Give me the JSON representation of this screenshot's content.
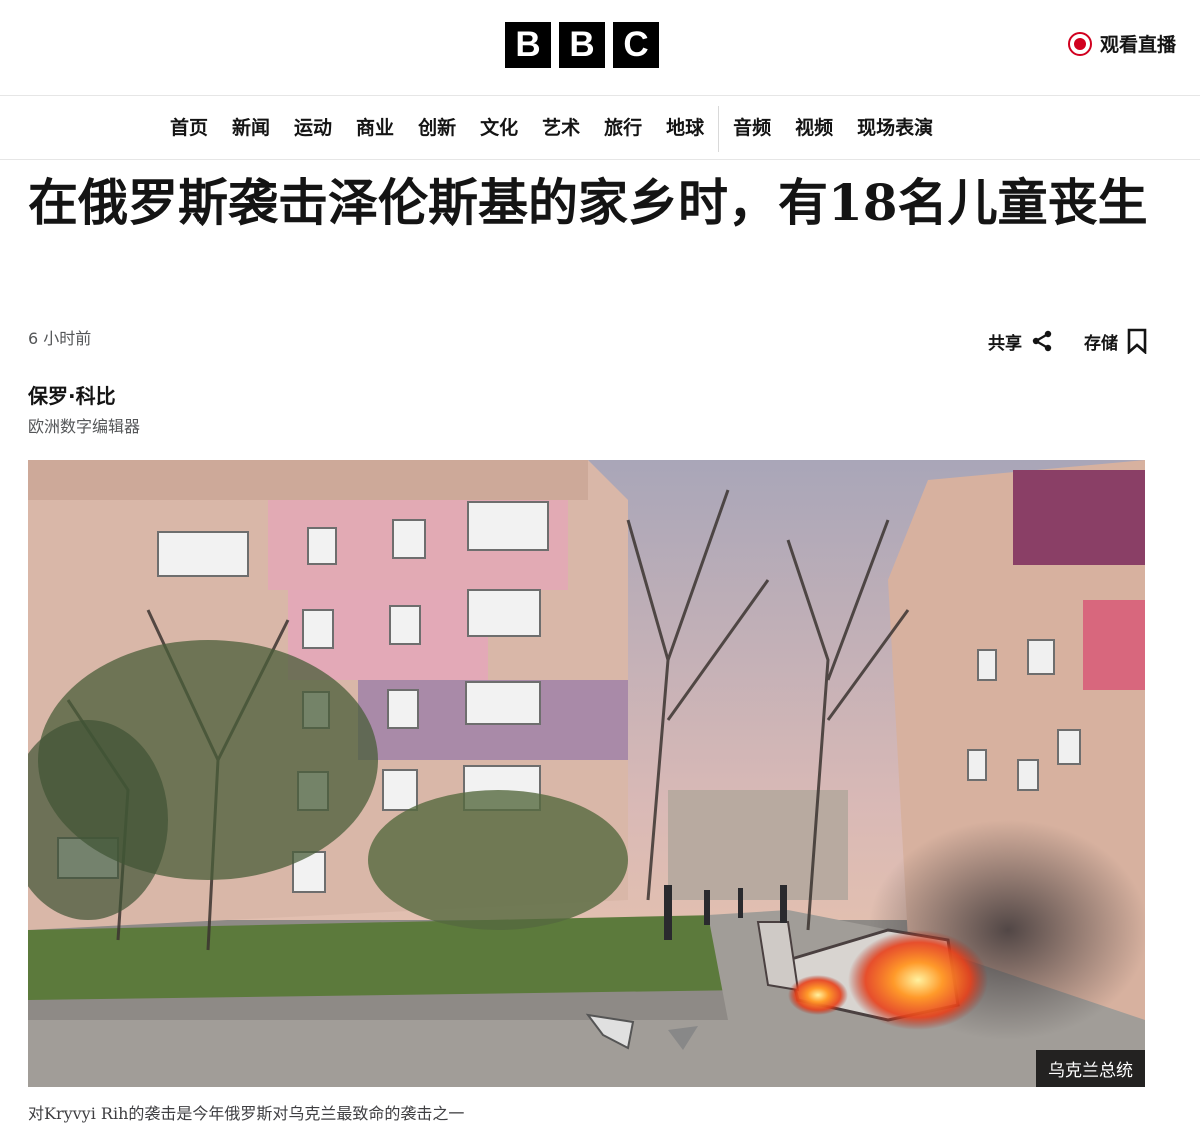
{
  "header": {
    "logo_letters": [
      "B",
      "B",
      "C"
    ],
    "live_label": "观看直播",
    "live_color": "#d1001f"
  },
  "nav": {
    "primary": [
      "首页",
      "新闻",
      "运动",
      "商业",
      "创新",
      "文化",
      "艺术",
      "旅行",
      "地球"
    ],
    "secondary": [
      "音频",
      "视频",
      "现场表演"
    ]
  },
  "article": {
    "headline": "在俄罗斯袭击泽伦斯基的家乡时，有18名儿童丧生",
    "timestamp": "6 小时前",
    "share_label": "共享",
    "save_label": "存储",
    "author": "保罗·科比",
    "author_role": "欧洲数字编辑器",
    "image_credit": "乌克兰总统",
    "caption": "对Kryvyi Rih的袭击是今年俄罗斯对乌克兰最致命的袭击之一"
  }
}
